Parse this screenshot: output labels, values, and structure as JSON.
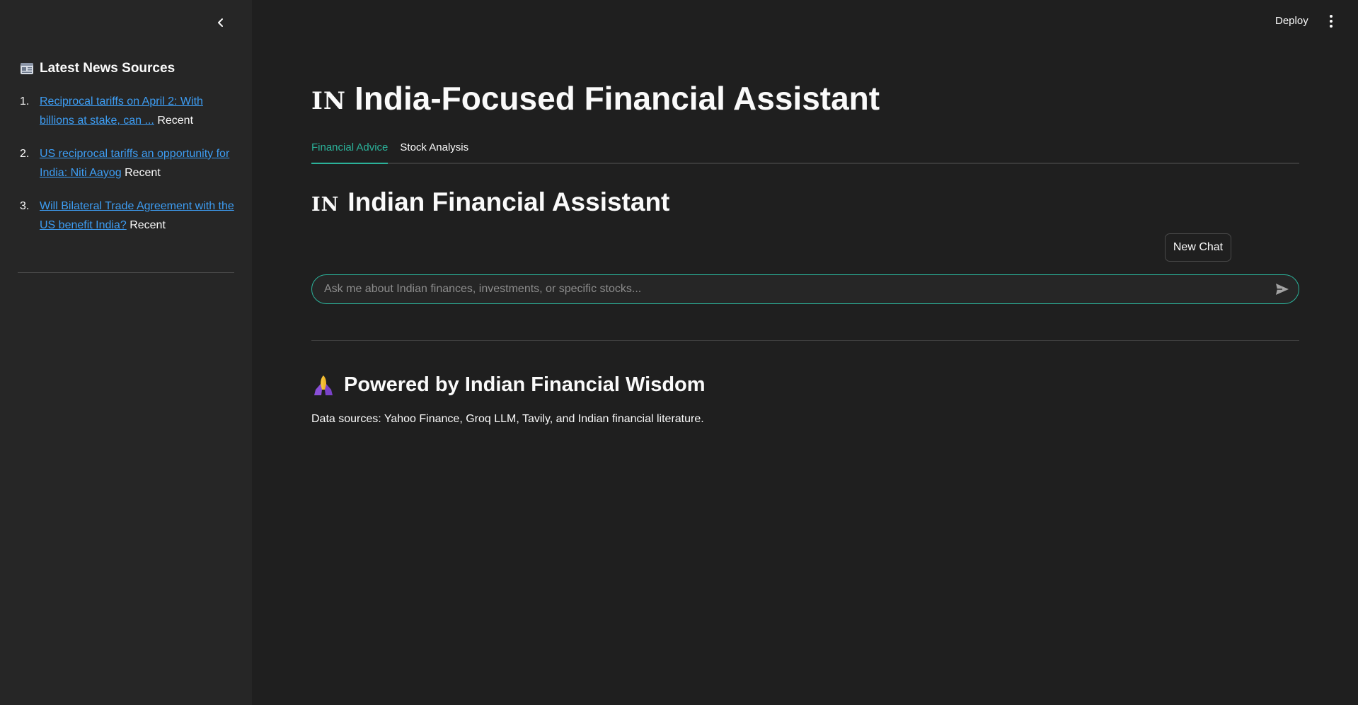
{
  "sidebar": {
    "collapse_icon": "chevron-left-icon",
    "title_icon": "newspaper-icon",
    "title": "Latest News Sources",
    "news": [
      {
        "num": "1.",
        "link": "Reciprocal tariffs on April 2: With billions at stake, can ...",
        "tag": "Recent"
      },
      {
        "num": "2.",
        "link": "US reciprocal tariffs an opportunity for India: Niti Aayog",
        "tag": "Recent"
      },
      {
        "num": "3.",
        "link": "Will Bilateral Trade Agreement with the US benefit India?",
        "tag": "Recent"
      }
    ]
  },
  "header": {
    "deploy_label": "Deploy",
    "menu_icon": "more-vertical-icon"
  },
  "main": {
    "title_flag": "IN",
    "title": "India-Focused Financial Assistant",
    "tabs": [
      {
        "label": "Financial Advice",
        "active": true
      },
      {
        "label": "Stock Analysis",
        "active": false
      }
    ],
    "section_flag": "IN",
    "section_title": "Indian Financial Assistant",
    "new_chat_label": "New Chat",
    "chat_placeholder": "Ask me about Indian finances, investments, or specific stocks...",
    "send_icon": "send-icon",
    "powered_icon": "folded-hands-icon",
    "powered_title": "Powered by Indian Financial Wisdom",
    "data_sources": "Data sources: Yahoo Finance, Groq LLM, Tavily, and Indian financial literature."
  },
  "colors": {
    "background": "#1f1f1f",
    "sidebar": "#262626",
    "accent": "#2bb29a",
    "link": "#3d9df3"
  }
}
